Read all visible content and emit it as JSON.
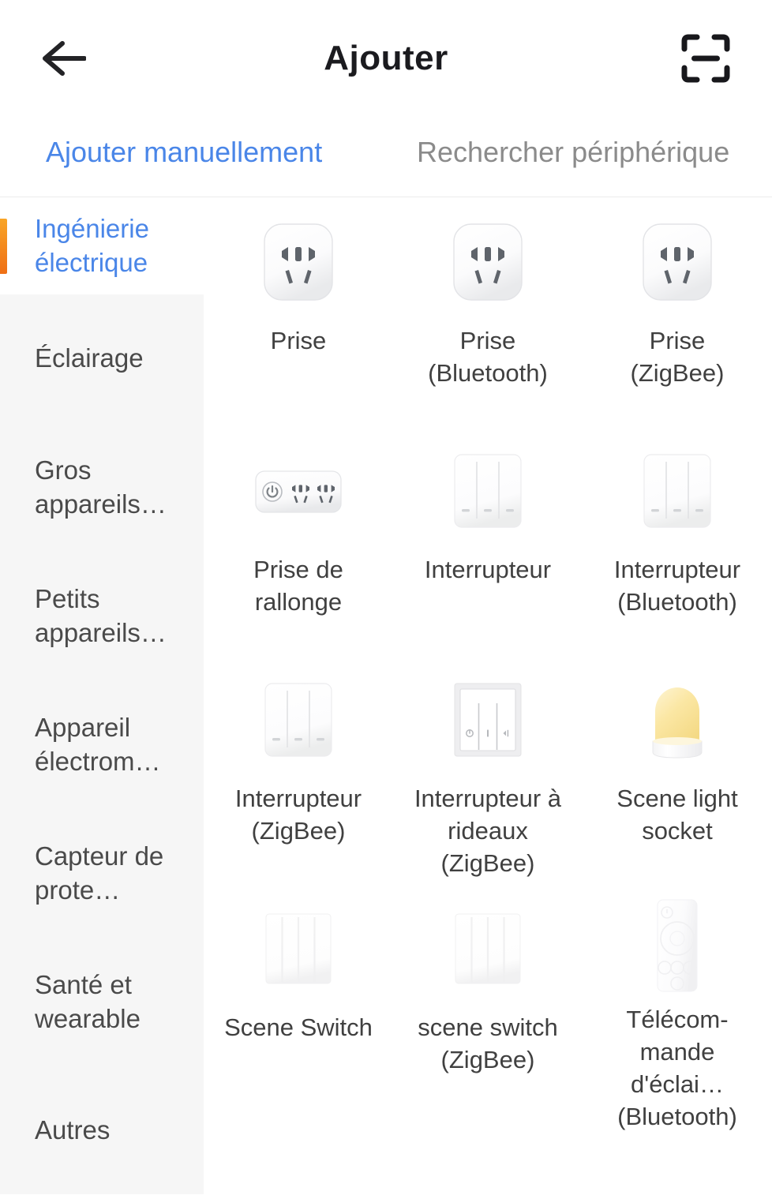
{
  "header": {
    "title": "Ajouter",
    "back_icon": "arrow-left-icon",
    "scan_icon": "scan-qr-icon"
  },
  "tabs": [
    {
      "label": "Ajouter manuellement",
      "active": true
    },
    {
      "label": "Rechercher périphérique",
      "active": false
    }
  ],
  "sidebar": {
    "items": [
      {
        "label": "Ingénierie\nélectrique",
        "active": true
      },
      {
        "label": "Éclairage",
        "active": false
      },
      {
        "label": "Gros\nappareils…",
        "active": false
      },
      {
        "label": "Petits\nappareils…",
        "active": false
      },
      {
        "label": "Appareil\nélectrom…",
        "active": false
      },
      {
        "label": "Capteur\nde prote…",
        "active": false
      },
      {
        "label": "Santé et\nwearable",
        "active": false
      },
      {
        "label": "Autres",
        "active": false
      }
    ]
  },
  "devices": [
    {
      "label": "Prise",
      "icon": "socket-icon"
    },
    {
      "label": "Prise\n(Bluetooth)",
      "icon": "socket-icon"
    },
    {
      "label": "Prise\n(ZigBee)",
      "icon": "socket-icon"
    },
    {
      "label": "Prise de\nrallonge",
      "icon": "power-strip-icon"
    },
    {
      "label": "Interrupteur",
      "icon": "wall-switch-icon"
    },
    {
      "label": "Interrupteur\n(Bluetooth)",
      "icon": "wall-switch-icon"
    },
    {
      "label": "Interrupteur\n(ZigBee)",
      "icon": "wall-switch-icon"
    },
    {
      "label": "Interrupteur à\nrideaux\n(ZigBee)",
      "icon": "curtain-switch-icon"
    },
    {
      "label": "Scene light\nsocket",
      "icon": "light-socket-icon"
    },
    {
      "label": "Scene Switch",
      "icon": "scene-switch-icon"
    },
    {
      "label": "scene switch\n(ZigBee)",
      "icon": "scene-switch-icon"
    },
    {
      "label": "Télécom-\nmande d'éclai…\n(Bluetooth)",
      "icon": "remote-control-icon"
    }
  ],
  "colors": {
    "accent_blue": "#4a86e8",
    "accent_orange": "#f2870f",
    "text_primary": "#1b1b1f",
    "text_secondary": "#8b8b8b",
    "sidebar_bg": "#f6f6f6",
    "lamp_yellow": "#f7e08f"
  }
}
